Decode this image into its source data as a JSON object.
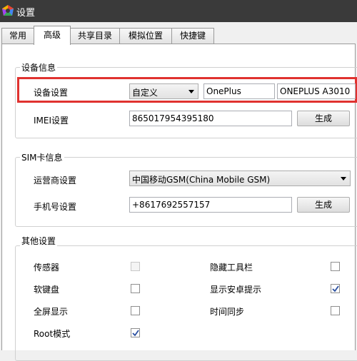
{
  "window": {
    "title": "设置"
  },
  "tabs": [
    {
      "label": "常用"
    },
    {
      "label": "高级",
      "active": true
    },
    {
      "label": "共享目录"
    },
    {
      "label": "模拟位置"
    },
    {
      "label": "快捷键"
    }
  ],
  "device_info": {
    "group_title": "设备信息",
    "device_label": "设备设置",
    "preset_value": "自定义",
    "brand_value": "OnePlus",
    "model_value": "ONEPLUS A3010",
    "imei_label": "IMEI设置",
    "imei_value": "865017954395180",
    "imei_generate": "生成"
  },
  "sim_info": {
    "group_title": "SIM卡信息",
    "carrier_label": "运营商设置",
    "carrier_value": "中国移动GSM(China Mobile GSM)",
    "phone_label": "手机号设置",
    "phone_value": "+8617692557157",
    "phone_generate": "生成"
  },
  "other_settings": {
    "group_title": "其他设置",
    "items": [
      {
        "label": "传感器",
        "checked": false,
        "enabled": false
      },
      {
        "label": "隐藏工具栏",
        "checked": false,
        "enabled": true
      },
      {
        "label": "软键盘",
        "checked": false,
        "enabled": true
      },
      {
        "label": "显示安卓提示",
        "checked": true,
        "enabled": true
      },
      {
        "label": "全屏显示",
        "checked": false,
        "enabled": true
      },
      {
        "label": "时间同步",
        "checked": false,
        "enabled": true
      },
      {
        "label": "Root模式",
        "checked": true,
        "enabled": true
      }
    ]
  },
  "colors": {
    "highlight": "#e0322f",
    "titlebar": "#3a3a3a"
  }
}
